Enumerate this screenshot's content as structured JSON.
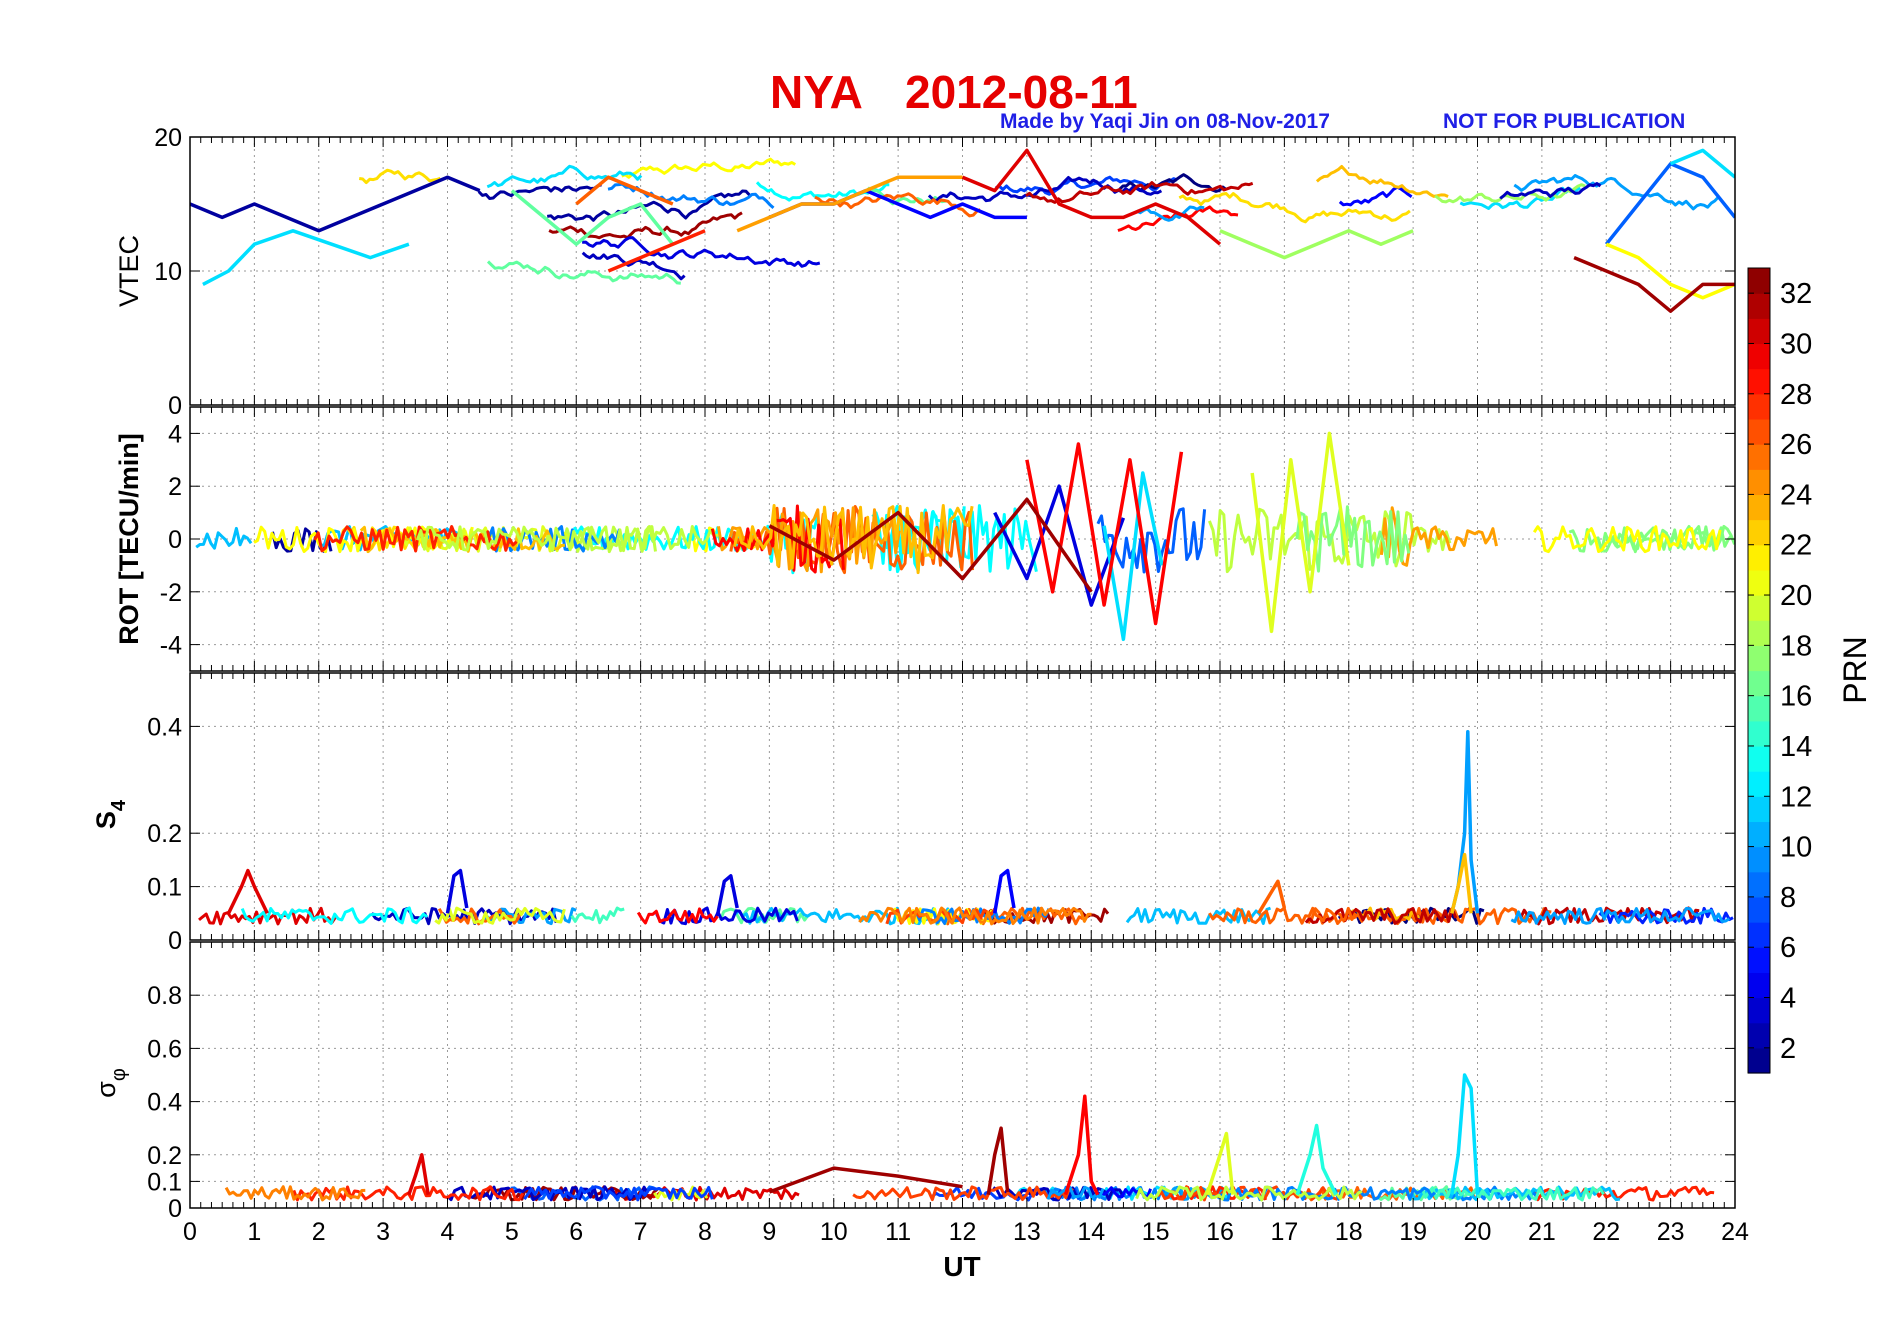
{
  "title": {
    "station": "NYA",
    "date": "2012-08-11",
    "credit": "Made by Yaqi Jin on 08-Nov-2017",
    "notice": "NOT FOR PUBLICATION"
  },
  "colors": {
    "title": "#e60000",
    "credit": "#1f1fe6",
    "grid": "#9a9a9a"
  },
  "chart_data": [
    {
      "type": "line",
      "panel": "vtec",
      "ylabel": "VTEC",
      "ylim": [
        0,
        20
      ],
      "yticks": [
        0,
        10,
        20
      ],
      "xlim": [
        0,
        24
      ],
      "grid": true,
      "series_note": "multi-satellite traces colored by PRN",
      "series": [
        {
          "prn": 2,
          "x": [
            0.0,
            0.5,
            1.0,
            1.5,
            2.0,
            2.5,
            3.0,
            3.5,
            4.0,
            4.5
          ],
          "y": [
            15,
            14,
            15,
            14,
            13,
            14,
            15,
            16,
            17,
            16
          ]
        },
        {
          "prn": 5,
          "x": [
            9.0,
            9.5,
            10.0,
            10.5,
            11.0,
            11.5,
            12.0,
            12.5,
            13.0
          ],
          "y": [
            14,
            15,
            15,
            16,
            15,
            14,
            15,
            14,
            14
          ]
        },
        {
          "prn": 8,
          "x": [
            22.0,
            22.5,
            23.0,
            23.5,
            24.0
          ],
          "y": [
            12,
            15,
            18,
            17,
            14
          ]
        },
        {
          "prn": 12,
          "x": [
            0.2,
            0.6,
            1.0,
            1.6,
            2.2,
            2.8,
            3.4
          ],
          "y": [
            9,
            10,
            12,
            13,
            12,
            11,
            12
          ]
        },
        {
          "prn": 12,
          "x": [
            23.0,
            23.5,
            24.0
          ],
          "y": [
            18,
            19,
            17
          ]
        },
        {
          "prn": 16,
          "x": [
            5.0,
            5.5,
            6.0,
            6.5,
            7.0,
            7.5
          ],
          "y": [
            16,
            14,
            12,
            14,
            15,
            12
          ]
        },
        {
          "prn": 18,
          "x": [
            16.0,
            16.5,
            17.0,
            17.5,
            18.0,
            18.5,
            19.0
          ],
          "y": [
            13,
            12,
            11,
            12,
            13,
            12,
            13
          ]
        },
        {
          "prn": 21,
          "x": [
            22.0,
            22.5,
            23.0,
            23.5,
            24.0
          ],
          "y": [
            12,
            11,
            9,
            8,
            9
          ]
        },
        {
          "prn": 24,
          "x": [
            8.5,
            9.0,
            9.5,
            10.0,
            10.5,
            11.0,
            11.5,
            12.0
          ],
          "y": [
            13,
            14,
            15,
            15,
            16,
            17,
            17,
            17
          ]
        },
        {
          "prn": 26,
          "x": [
            6.0,
            6.5,
            7.0,
            7.5
          ],
          "y": [
            15,
            17,
            16,
            15
          ]
        },
        {
          "prn": 28,
          "x": [
            6.5,
            7.0,
            7.5,
            8.0
          ],
          "y": [
            10,
            11,
            12,
            13
          ]
        },
        {
          "prn": 30,
          "x": [
            12.0,
            12.5,
            13.0,
            13.5,
            14.0,
            14.5,
            15.0,
            15.5,
            16.0
          ],
          "y": [
            17,
            16,
            19,
            15,
            14,
            14,
            15,
            14,
            12
          ]
        },
        {
          "prn": 32,
          "x": [
            21.5,
            22.0,
            22.5,
            23.0,
            23.5,
            24.0
          ],
          "y": [
            11,
            10,
            9,
            7,
            9,
            9
          ]
        }
      ]
    },
    {
      "type": "line",
      "panel": "rot",
      "ylabel": "ROT [TECU/min]",
      "ylim": [
        -5,
        5
      ],
      "yticks": [
        -4,
        -2,
        0,
        2,
        4
      ],
      "xlim": [
        0,
        24
      ],
      "grid": true,
      "series": [
        {
          "prn": 4,
          "x": [
            12.5,
            13.0,
            13.5,
            14.0,
            14.5
          ],
          "y": [
            1.0,
            -1.5,
            2.0,
            -2.5,
            0.8
          ]
        },
        {
          "prn": 12,
          "x": [
            14.2,
            14.5,
            14.8,
            15.1
          ],
          "y": [
            0.5,
            -3.8,
            2.5,
            -1.0
          ]
        },
        {
          "prn": 20,
          "x": [
            16.5,
            16.8,
            17.1,
            17.4,
            17.7,
            18.0
          ],
          "y": [
            2.5,
            -3.5,
            3.0,
            -2.0,
            4.0,
            -1.0
          ]
        },
        {
          "prn": 29,
          "x": [
            13.0,
            13.4,
            13.8,
            14.2,
            14.6,
            15.0,
            15.4
          ],
          "y": [
            3.0,
            -2.0,
            3.6,
            -2.5,
            3.0,
            -3.2,
            3.3
          ]
        },
        {
          "prn": 32,
          "x": [
            9.0,
            10.0,
            11.0,
            12.0,
            13.0,
            14.0
          ],
          "y": [
            0.5,
            -0.8,
            1.0,
            -1.5,
            1.5,
            -2.0
          ]
        }
      ]
    },
    {
      "type": "line",
      "panel": "s4",
      "ylabel": "S4",
      "ylim": [
        0,
        0.5
      ],
      "yticks": [
        0,
        0.1,
        0.2,
        0.4
      ],
      "xlim": [
        0,
        24
      ],
      "grid": true,
      "series": [
        {
          "prn": 10,
          "x": [
            19.6,
            19.7,
            19.8,
            19.85,
            19.9,
            20.0
          ],
          "y": [
            0.05,
            0.1,
            0.2,
            0.39,
            0.15,
            0.05
          ]
        },
        {
          "prn": 23,
          "x": [
            19.6,
            19.7,
            19.8,
            19.9
          ],
          "y": [
            0.05,
            0.1,
            0.16,
            0.05
          ]
        },
        {
          "prn": 30,
          "x": [
            0.6,
            0.8,
            0.9,
            1.0,
            1.2
          ],
          "y": [
            0.05,
            0.1,
            0.13,
            0.1,
            0.05
          ]
        },
        {
          "prn": 26,
          "x": [
            16.6,
            16.8,
            16.9,
            17.0
          ],
          "y": [
            0.05,
            0.09,
            0.11,
            0.06
          ]
        },
        {
          "prn": 4,
          "x": [
            4.0,
            4.1,
            4.2,
            4.3
          ],
          "y": [
            0.05,
            0.12,
            0.13,
            0.06
          ]
        },
        {
          "prn": 4,
          "x": [
            8.2,
            8.3,
            8.4,
            8.5
          ],
          "y": [
            0.05,
            0.11,
            0.12,
            0.06
          ]
        },
        {
          "prn": 5,
          "x": [
            12.5,
            12.6,
            12.7,
            12.8
          ],
          "y": [
            0.05,
            0.12,
            0.13,
            0.06
          ]
        }
      ]
    },
    {
      "type": "line",
      "panel": "sigma_phi",
      "ylabel": "σφ",
      "ylim": [
        0,
        1
      ],
      "yticks": [
        0,
        0.1,
        0.2,
        0.4,
        0.6,
        0.8
      ],
      "xlim": [
        0,
        24
      ],
      "xticks": [
        0,
        1,
        2,
        3,
        4,
        5,
        6,
        7,
        8,
        9,
        10,
        11,
        12,
        13,
        14,
        15,
        16,
        17,
        18,
        19,
        20,
        21,
        22,
        23,
        24
      ],
      "xlabel": "UT",
      "grid": true,
      "series": [
        {
          "prn": 12,
          "x": [
            19.6,
            19.7,
            19.8,
            19.9,
            20.0
          ],
          "y": [
            0.05,
            0.2,
            0.5,
            0.45,
            0.05
          ]
        },
        {
          "prn": 29,
          "x": [
            13.6,
            13.8,
            13.9,
            14.0,
            14.1
          ],
          "y": [
            0.05,
            0.2,
            0.42,
            0.1,
            0.05
          ]
        },
        {
          "prn": 32,
          "x": [
            12.4,
            12.5,
            12.6,
            12.7
          ],
          "y": [
            0.05,
            0.2,
            0.3,
            0.06
          ]
        },
        {
          "prn": 32,
          "x": [
            9.0,
            10.0,
            11.0,
            12.0
          ],
          "y": [
            0.06,
            0.15,
            0.12,
            0.08
          ]
        },
        {
          "prn": 14,
          "x": [
            17.2,
            17.4,
            17.5,
            17.6,
            17.8
          ],
          "y": [
            0.05,
            0.2,
            0.31,
            0.15,
            0.05
          ]
        },
        {
          "prn": 20,
          "x": [
            15.8,
            16.0,
            16.1,
            16.2
          ],
          "y": [
            0.05,
            0.2,
            0.28,
            0.05
          ]
        },
        {
          "prn": 30,
          "x": [
            3.4,
            3.5,
            3.6,
            3.7
          ],
          "y": [
            0.05,
            0.12,
            0.2,
            0.05
          ]
        }
      ]
    }
  ],
  "colorbar": {
    "label": "PRN",
    "range": [
      1,
      33
    ],
    "ticks": [
      2,
      4,
      6,
      8,
      10,
      12,
      14,
      16,
      18,
      20,
      22,
      24,
      26,
      28,
      30,
      32
    ],
    "colormap": "jet"
  }
}
